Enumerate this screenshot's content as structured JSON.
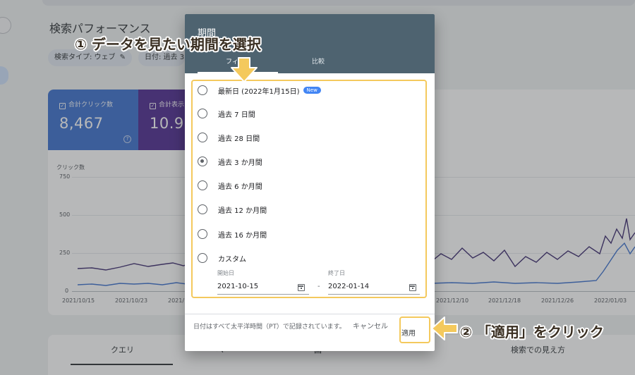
{
  "background": {
    "page_title": "検索パフォーマンス",
    "filter_chips": [
      "検索タイプ: ウェブ",
      "日付: 過去 3"
    ],
    "metrics": [
      {
        "label": "合計クリック数",
        "value": "8,467",
        "color": "#4a7bd1"
      },
      {
        "label": "合計表示",
        "value": "10.9",
        "color": "#5b3a98"
      }
    ],
    "chart": {
      "y_title": "クリック数",
      "y_ticks": [
        "750",
        "500",
        "250",
        "0"
      ],
      "x_ticks": [
        "2021/10/15",
        "2021/10/23",
        "2021/10",
        "2021/12/10",
        "2021/12/18",
        "2021/12/26",
        "2022/01/03"
      ]
    },
    "bottom_tabs": [
      "クエリ",
      "ペ",
      "国",
      "検索での見え方"
    ]
  },
  "dialog": {
    "title": "期間",
    "tabs": [
      "フィルタ",
      "比較"
    ],
    "options": [
      {
        "label": "最新日 (2022年1月15日)",
        "badge": "New",
        "selected": false
      },
      {
        "label": "過去 7 日間",
        "selected": false
      },
      {
        "label": "過去 28 日間",
        "selected": false
      },
      {
        "label": "過去 3 か月間",
        "selected": true
      },
      {
        "label": "過去 6 か月間",
        "selected": false
      },
      {
        "label": "過去 12 か月間",
        "selected": false
      },
      {
        "label": "過去 16 か月間",
        "selected": false
      },
      {
        "label": "カスタム",
        "selected": false
      }
    ],
    "custom": {
      "start_caption": "開始日",
      "start_value": "2021-10-15",
      "separator": "-",
      "end_caption": "終了日",
      "end_value": "2022-01-14"
    },
    "footnote": "日付はすべて太平洋時間（PT）で記録されています。",
    "cancel_label": "キャンセル",
    "apply_label": "適用"
  },
  "annotations": {
    "step1": "① データを見たい期間を選択",
    "step2": "② 「適用」をクリック",
    "color": "#f4c95d"
  }
}
